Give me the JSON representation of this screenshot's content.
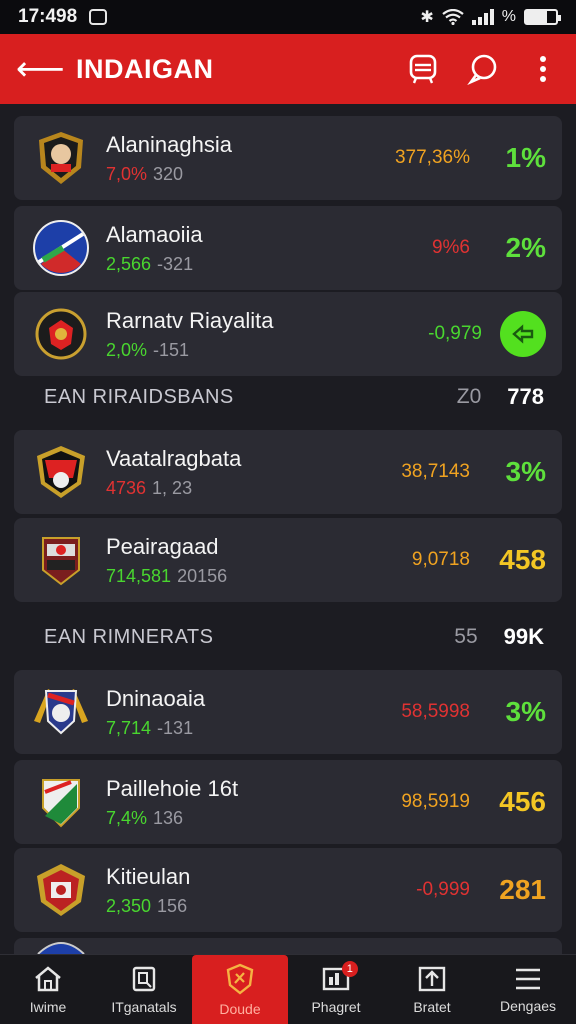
{
  "status": {
    "time": "17:498",
    "battery_level": 0.7
  },
  "header": {
    "title": "INDAIGAN"
  },
  "cards": [
    {
      "name": "Alaninaghsia",
      "sub_a": "7,0%",
      "sub_b": "320",
      "mid": "377,36%",
      "big": "1%"
    },
    {
      "name": "Alamaoiia",
      "sub_a": "2,566",
      "sub_b": "-321",
      "mid": "9%6",
      "big": "2%"
    },
    {
      "name": "Rarnatv Riayalita",
      "sub_a": "2,0%",
      "sub_b": "-151",
      "mid": "-0,979"
    },
    {
      "name": "Vaatalragbata",
      "sub_a": "4736",
      "sub_b": "1, 23",
      "mid": "38,7143",
      "big": "3%"
    },
    {
      "name": "Peairagaad",
      "sub_a": "714,581",
      "sub_b": "20156",
      "mid": "9,0718",
      "big": "458"
    },
    {
      "name": "Dninaoaia",
      "sub_a": "7,714",
      "sub_b": "-131",
      "mid": "58,5998",
      "big": "3%"
    },
    {
      "name": "Paillehoie 16t",
      "sub_a": "7,4%",
      "sub_b": "136",
      "mid": "98,5919",
      "big": "456"
    },
    {
      "name": "Kitieulan",
      "sub_a": "2,350",
      "sub_b": "156",
      "mid": "-0,999",
      "big": "281"
    }
  ],
  "sections": [
    {
      "title": "EAN RIRAIDSBANS",
      "a": "Z0",
      "b": "778"
    },
    {
      "title": "EAN RIMNERATS",
      "a": "55",
      "b": "99K"
    }
  ],
  "nav": [
    {
      "label": "Iwime",
      "icon": "home-icon"
    },
    {
      "label": "ITganatals",
      "icon": "ticket-icon"
    },
    {
      "label": "Doude",
      "icon": "shield-icon"
    },
    {
      "label": "Phagret",
      "icon": "stats-icon",
      "badge": "1"
    },
    {
      "label": "Bratet",
      "icon": "upload-icon"
    },
    {
      "label": "Dengaes",
      "icon": "menu-icon"
    }
  ],
  "colors": {
    "accent": "#d81f1f",
    "background": "#1c1c22",
    "card": "#2b2b33",
    "positive": "#49d62f",
    "negative": "#e03232",
    "highlight": "#f0a321"
  }
}
